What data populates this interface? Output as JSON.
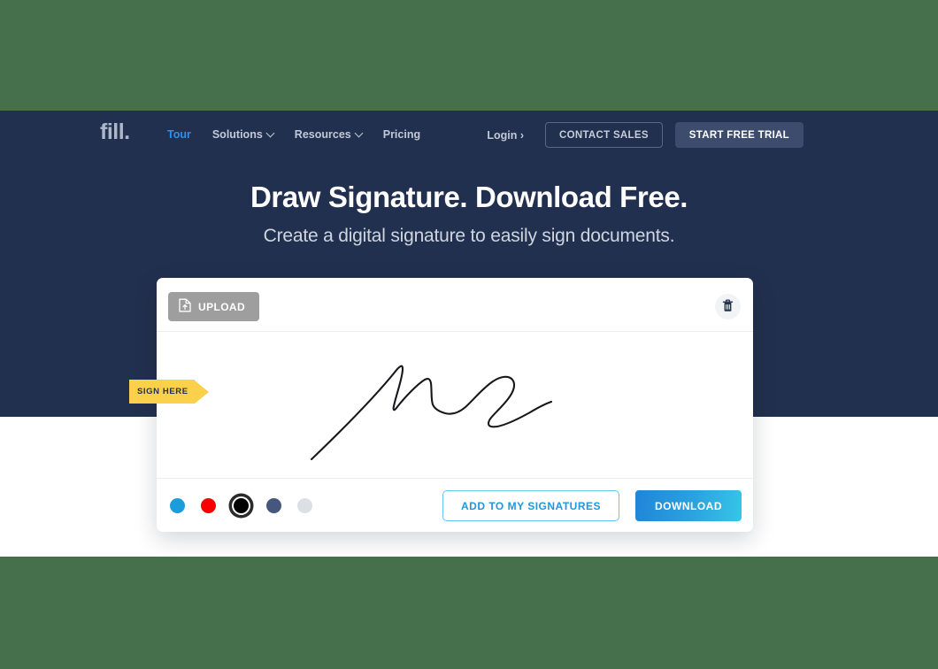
{
  "colors": {
    "backdrop_green": "#46704b",
    "hero_navy": "#22304f",
    "accent_blue": "#2f90e8",
    "tag_yellow": "#fbd14b",
    "upload_gray": "#9e9e9e"
  },
  "navbar": {
    "logo": "fill.",
    "links": [
      {
        "label": "Tour",
        "active": true,
        "caret": false
      },
      {
        "label": "Solutions",
        "active": false,
        "caret": true
      },
      {
        "label": "Resources",
        "active": false,
        "caret": true
      },
      {
        "label": "Pricing",
        "active": false,
        "caret": false
      }
    ],
    "login_label": "Login ›",
    "contact_sales_label": "CONTACT SALES",
    "start_trial_label": "START FREE TRIAL"
  },
  "hero": {
    "title": "Draw Signature. Download Free.",
    "subtitle": "Create a digital signature to easily sign documents."
  },
  "card": {
    "upload_label": "UPLOAD",
    "upload_icon": "document-upload-icon",
    "trash_icon": "trash-icon",
    "sign_here_label": "SIGN HERE",
    "signature_alt": "handwritten-signature",
    "swatches": [
      {
        "name": "blue",
        "hex": "#1b9ddd",
        "selected": false
      },
      {
        "name": "red",
        "hex": "#f90000",
        "selected": false
      },
      {
        "name": "black",
        "hex": "#000000",
        "selected": true
      },
      {
        "name": "slate",
        "hex": "#46577d",
        "selected": false
      },
      {
        "name": "light-gray",
        "hex": "#dcdfe3",
        "selected": false
      }
    ],
    "add_signatures_label": "ADD TO MY SIGNATURES",
    "download_label": "DOWNLOAD"
  }
}
